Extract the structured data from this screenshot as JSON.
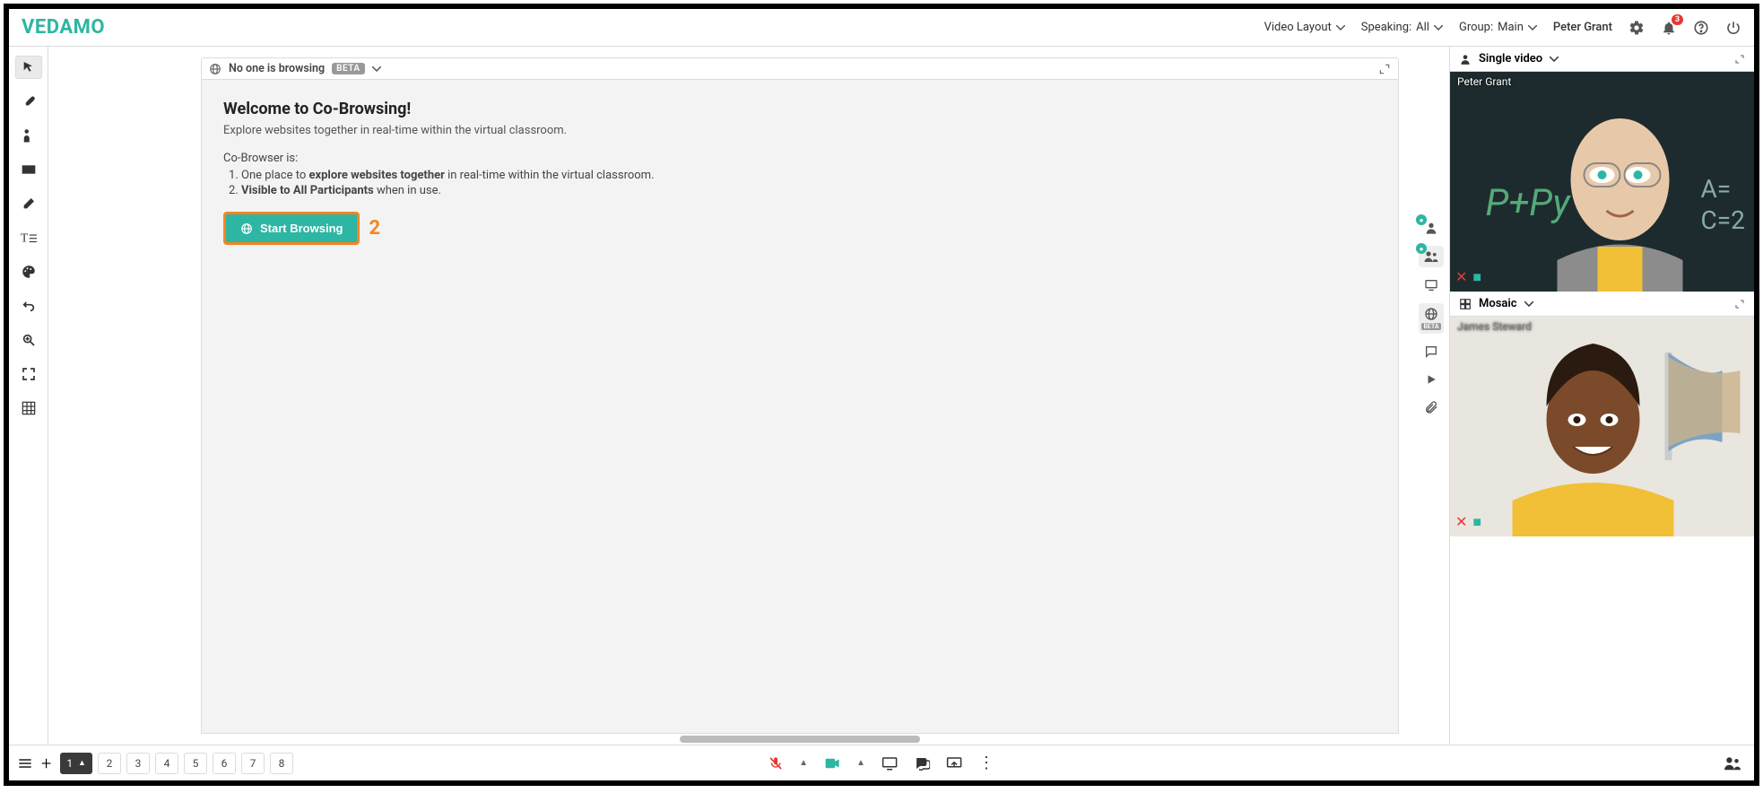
{
  "brand": "VEDAMO",
  "header": {
    "video_layout": "Video Layout",
    "speaking_label": "Speaking:",
    "speaking_value": "All",
    "group_label": "Group:",
    "group_value": "Main",
    "user_name": "Peter Grant",
    "notif_count": "3"
  },
  "toolbar": {
    "items": [
      "pointer",
      "brush",
      "presenter",
      "rectangle",
      "eraser",
      "text",
      "palette",
      "undo",
      "zoom",
      "fit",
      "grid"
    ]
  },
  "cobrowse": {
    "bar_text": "No one is browsing",
    "beta": "BETA",
    "title": "Welcome to Co-Browsing!",
    "subtitle": "Explore websites together in real-time within the virtual classroom.",
    "list_heading": "Co-Browser is:",
    "item1_prefix": "One place to ",
    "item1_bold": "explore websites together",
    "item1_suffix": " in real-time within the virtual classroom.",
    "item2_bold": "Visible to All Participants",
    "item2_suffix": " when in use.",
    "start_button": "Start Browsing",
    "callout_number": "2"
  },
  "right_panel": {
    "single_label": "Single video",
    "mosaic_label": "Mosaic",
    "tiles": [
      {
        "name": "Peter Grant"
      },
      {
        "name": "James Steward"
      }
    ]
  },
  "mid_dock": {
    "beta": "BETA"
  },
  "footer": {
    "pages": [
      "1",
      "2",
      "3",
      "4",
      "5",
      "6",
      "7",
      "8"
    ],
    "active_page": "1"
  }
}
